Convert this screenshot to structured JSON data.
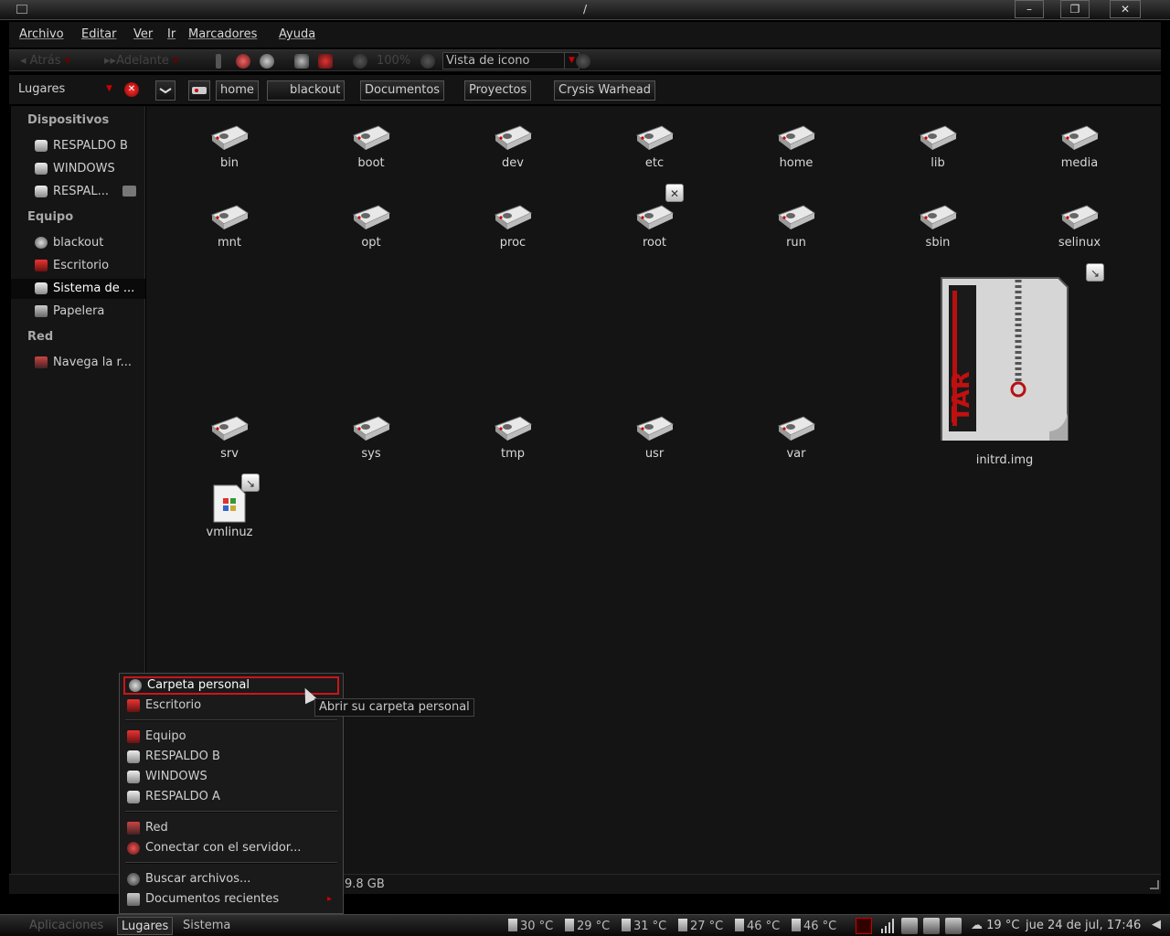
{
  "window": {
    "title": "/"
  },
  "menubar": [
    "Archivo",
    "Editar",
    "Ver",
    "Ir",
    "Marcadores",
    "Ayuda"
  ],
  "toolbar": {
    "back": "Atrás",
    "forward": "Adelante",
    "zoom": "100%",
    "view_mode": "Vista de icono"
  },
  "location": {
    "places_label": "Lugares",
    "crumbs": [
      "home",
      "blackout",
      "Documentos",
      "Proyectos",
      "Crysis Warhead"
    ]
  },
  "sidebar": {
    "devices_heading": "Dispositivos",
    "devices": [
      "RESPALDO B",
      "WINDOWS",
      "RESPAL..."
    ],
    "computer_heading": "Equipo",
    "computer": [
      "blackout",
      "Escritorio",
      "Sistema de ...",
      "Papelera"
    ],
    "network_heading": "Red",
    "network": [
      "Navega la r..."
    ]
  },
  "files": {
    "row1": [
      "bin",
      "boot",
      "dev",
      "etc",
      "home",
      "lib",
      "media"
    ],
    "row2": [
      "mnt",
      "opt",
      "proc",
      "root",
      "run",
      "sbin",
      "selinux"
    ],
    "row3": [
      "srv",
      "sys",
      "tmp",
      "usr",
      "var"
    ],
    "archive": "initrd.img",
    "archive_badge": "TAR",
    "kernel": "vmlinuz"
  },
  "status": {
    "free_space": "9.8 GB"
  },
  "places_menu": {
    "home": "Carpeta personal",
    "desktop": "Escritorio",
    "computer": "Equipo",
    "respaldo_b": "RESPALDO B",
    "windows": "WINDOWS",
    "respaldo_a": "RESPALDO A",
    "network": "Red",
    "connect": "Conectar con el servidor...",
    "search": "Buscar archivos...",
    "recent": "Documentos recientes"
  },
  "tooltip": "Abrir su carpeta personal",
  "panel": {
    "apps": "Aplicaciones",
    "places": "Lugares",
    "system": "Sistema",
    "temps": [
      "30 °C",
      "29 °C",
      "31 °C",
      "27 °C",
      "46 °C",
      "46 °C"
    ],
    "weather": "19 °C",
    "clock": "jue 24 de jul, 17:46"
  },
  "colors": {
    "accent": "#c8161a",
    "background": "#141414"
  }
}
